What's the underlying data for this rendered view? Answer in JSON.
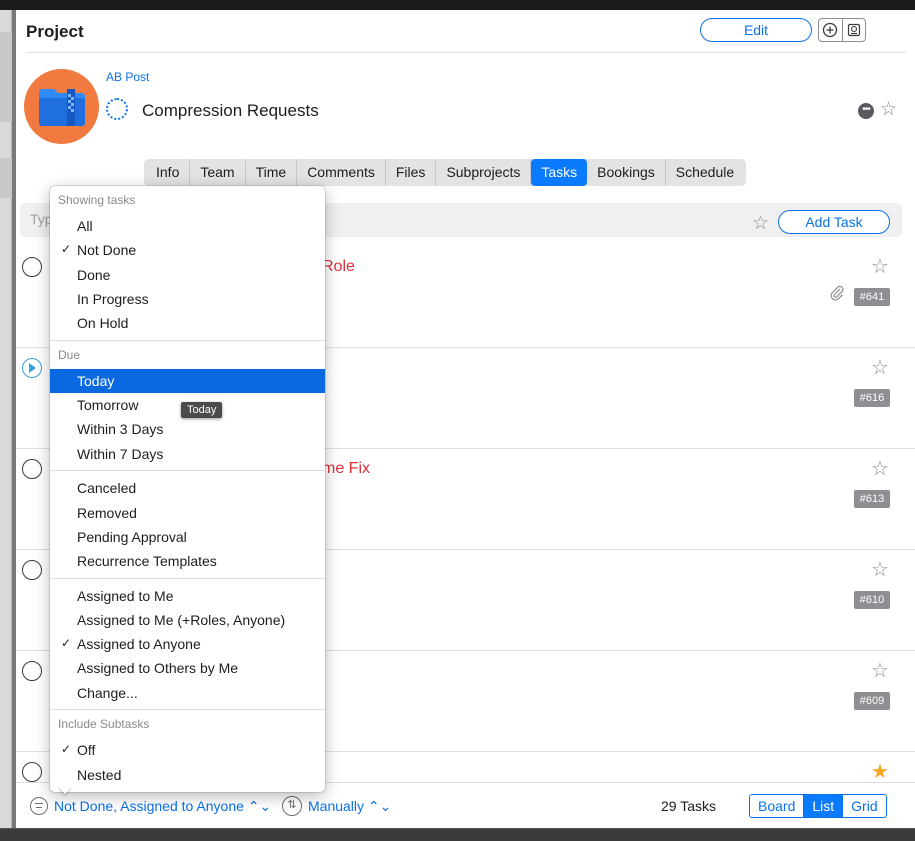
{
  "header": {
    "title": "Project",
    "edit_label": "Edit"
  },
  "project": {
    "parent": "AB Post",
    "name": "Compression Requests"
  },
  "tabs": [
    {
      "label": "Info"
    },
    {
      "label": "Team"
    },
    {
      "label": "Time"
    },
    {
      "label": "Comments"
    },
    {
      "label": "Files"
    },
    {
      "label": "Subprojects"
    },
    {
      "label": "Tasks",
      "active": true
    },
    {
      "label": "Bookings"
    },
    {
      "label": "Schedule"
    }
  ],
  "task_input": {
    "placeholder": "Typ",
    "add_label": "Add Task"
  },
  "tasks": [
    {
      "title": "Role",
      "number": "#641",
      "has_attachment": true,
      "starred": false
    },
    {
      "title": "",
      "number": "#616",
      "has_attachment": false,
      "starred": false
    },
    {
      "title": "me Fix",
      "number": "#613",
      "has_attachment": false,
      "starred": false
    },
    {
      "title": "",
      "number": "#610",
      "has_attachment": false,
      "starred": false
    },
    {
      "title": "",
      "number": "#609",
      "has_attachment": false,
      "starred": false
    },
    {
      "title": "",
      "number": "",
      "has_attachment": false,
      "starred": true
    }
  ],
  "menu": {
    "sections": {
      "showing": "Showing tasks",
      "due": "Due",
      "subtasks": "Include Subtasks"
    },
    "showing_items": [
      {
        "label": "All",
        "checked": false
      },
      {
        "label": "Not Done",
        "checked": true
      },
      {
        "label": "Done",
        "checked": false
      },
      {
        "label": "In Progress",
        "checked": false
      },
      {
        "label": "On Hold",
        "checked": false
      }
    ],
    "due_items": [
      {
        "label": "Today",
        "selected": true
      },
      {
        "label": "Tomorrow"
      },
      {
        "label": "Within 3 Days"
      },
      {
        "label": "Within 7 Days"
      }
    ],
    "state_items": [
      {
        "label": "Canceled"
      },
      {
        "label": "Removed"
      },
      {
        "label": "Pending Approval"
      },
      {
        "label": "Recurrence Templates"
      }
    ],
    "assign_items": [
      {
        "label": "Assigned to Me",
        "checked": false
      },
      {
        "label": "Assigned to Me (+Roles, Anyone)",
        "checked": false
      },
      {
        "label": "Assigned to Anyone",
        "checked": true
      },
      {
        "label": "Assigned to Others by Me",
        "checked": false
      },
      {
        "label": "Change...",
        "checked": false
      }
    ],
    "subtask_items": [
      {
        "label": "Off",
        "checked": true
      },
      {
        "label": "Nested",
        "checked": false
      }
    ],
    "check_glyph": "✓"
  },
  "tooltip": "Today",
  "footer": {
    "filter_label": "Not Done, Assigned to Anyone ⌃⌄",
    "sort_label": "Manually ⌃⌄",
    "count_label": "29 Tasks",
    "views": [
      {
        "label": "Board"
      },
      {
        "label": "List",
        "active": true
      },
      {
        "label": "Grid"
      }
    ]
  },
  "colors": {
    "accent": "#0a7aff",
    "overdue": "#e0303a",
    "star_filled": "#f5a623",
    "avatar_bg": "#f07a3f"
  }
}
